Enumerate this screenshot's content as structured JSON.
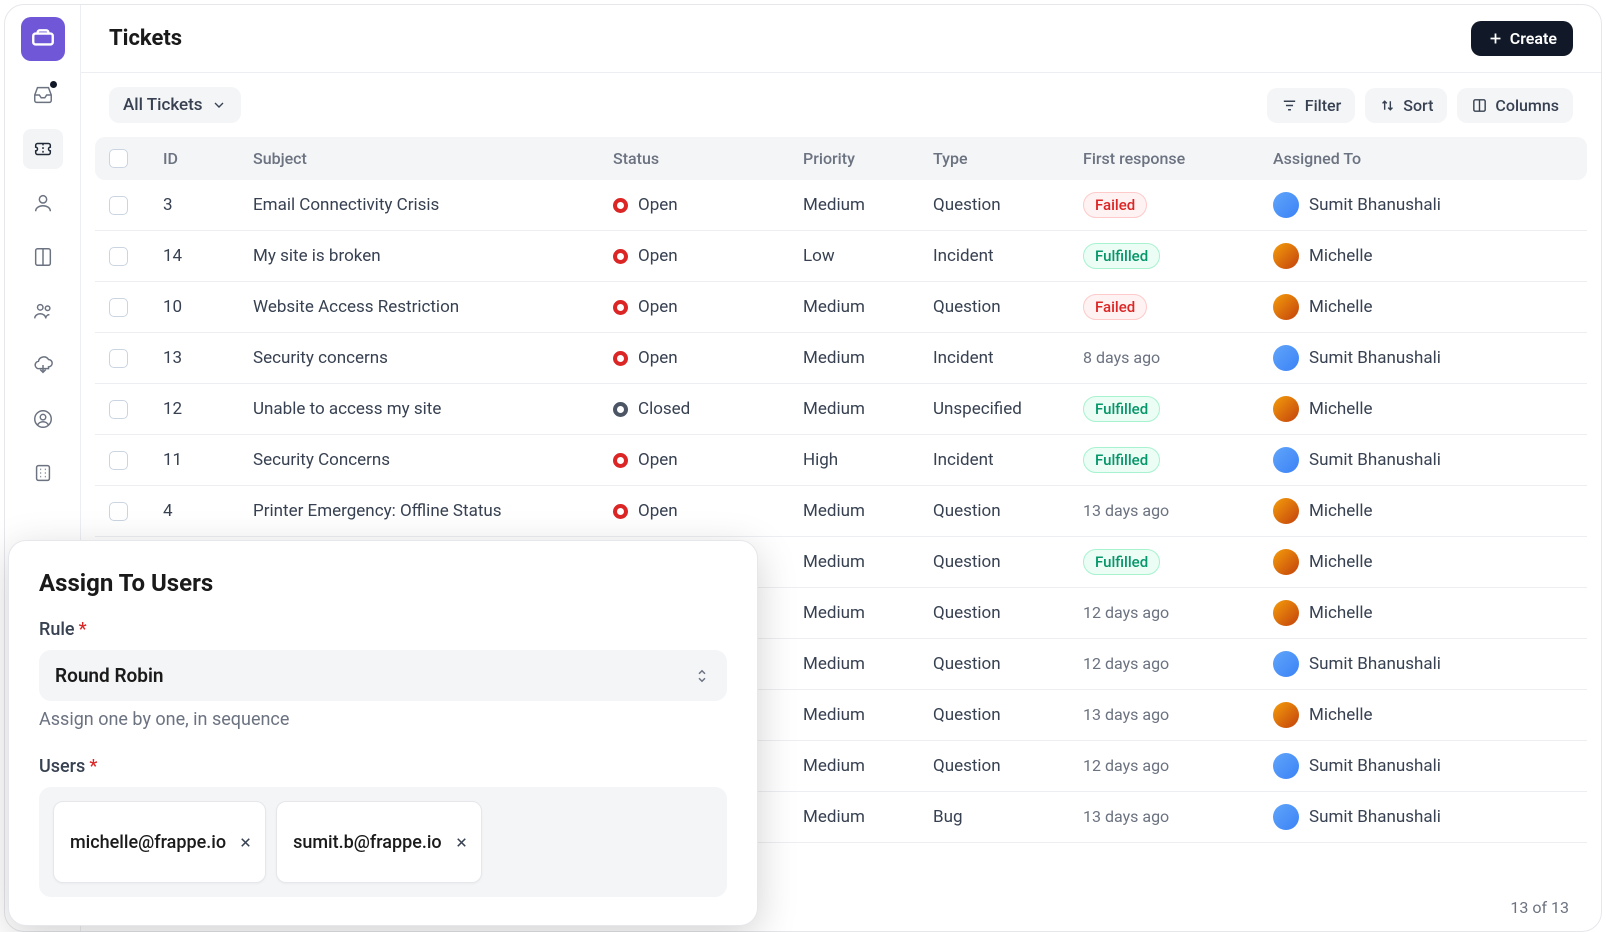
{
  "header": {
    "title": "Tickets",
    "create_label": "Create"
  },
  "toolbar": {
    "dropdown_label": "All Tickets",
    "filter_label": "Filter",
    "sort_label": "Sort",
    "columns_label": "Columns"
  },
  "columns": {
    "id": "ID",
    "subject": "Subject",
    "status": "Status",
    "priority": "Priority",
    "type": "Type",
    "first_response": "First response",
    "assigned_to": "Assigned To"
  },
  "rows": [
    {
      "id": "3",
      "subject": "Email Connectivity Crisis",
      "status": "Open",
      "priority": "Medium",
      "type": "Question",
      "first_response": {
        "kind": "badge",
        "value": "Failed"
      },
      "assigned": {
        "name": "Sumit Bhanushali",
        "avatar": "a1"
      }
    },
    {
      "id": "14",
      "subject": "My site is broken",
      "status": "Open",
      "priority": "Low",
      "type": "Incident",
      "first_response": {
        "kind": "badge",
        "value": "Fulfilled"
      },
      "assigned": {
        "name": "Michelle",
        "avatar": "a2"
      }
    },
    {
      "id": "10",
      "subject": "Website Access Restriction",
      "status": "Open",
      "priority": "Medium",
      "type": "Question",
      "first_response": {
        "kind": "badge",
        "value": "Failed"
      },
      "assigned": {
        "name": "Michelle",
        "avatar": "a2"
      }
    },
    {
      "id": "13",
      "subject": "Security concerns",
      "status": "Open",
      "priority": "Medium",
      "type": "Incident",
      "first_response": {
        "kind": "text",
        "value": "8 days ago"
      },
      "assigned": {
        "name": "Sumit Bhanushali",
        "avatar": "a1"
      }
    },
    {
      "id": "12",
      "subject": "Unable to access my site",
      "status": "Closed",
      "priority": "Medium",
      "type": "Unspecified",
      "first_response": {
        "kind": "badge",
        "value": "Fulfilled"
      },
      "assigned": {
        "name": "Michelle",
        "avatar": "a2"
      }
    },
    {
      "id": "11",
      "subject": "Security Concerns",
      "status": "Open",
      "priority": "High",
      "type": "Incident",
      "first_response": {
        "kind": "badge",
        "value": "Fulfilled"
      },
      "assigned": {
        "name": "Sumit Bhanushali",
        "avatar": "a1"
      }
    },
    {
      "id": "4",
      "subject": "Printer Emergency: Offline Status",
      "status": "Open",
      "priority": "Medium",
      "type": "Question",
      "first_response": {
        "kind": "text",
        "value": "13 days ago"
      },
      "assigned": {
        "name": "Michelle",
        "avatar": "a2"
      }
    },
    {
      "id": "",
      "subject": "",
      "status": "",
      "priority": "Medium",
      "type": "Question",
      "first_response": {
        "kind": "badge",
        "value": "Fulfilled"
      },
      "assigned": {
        "name": "Michelle",
        "avatar": "a2"
      }
    },
    {
      "id": "",
      "subject": "",
      "status": "",
      "priority": "Medium",
      "type": "Question",
      "first_response": {
        "kind": "text",
        "value": "12 days ago"
      },
      "assigned": {
        "name": "Michelle",
        "avatar": "a2"
      }
    },
    {
      "id": "",
      "subject": "",
      "status": "",
      "priority": "Medium",
      "type": "Question",
      "first_response": {
        "kind": "text",
        "value": "12 days ago"
      },
      "assigned": {
        "name": "Sumit Bhanushali",
        "avatar": "a1"
      }
    },
    {
      "id": "",
      "subject": "",
      "status": "",
      "priority": "Medium",
      "type": "Question",
      "first_response": {
        "kind": "text",
        "value": "13 days ago"
      },
      "assigned": {
        "name": "Michelle",
        "avatar": "a2"
      }
    },
    {
      "id": "",
      "subject": "",
      "status": "",
      "priority": "Medium",
      "type": "Question",
      "first_response": {
        "kind": "text",
        "value": "12 days ago"
      },
      "assigned": {
        "name": "Sumit Bhanushali",
        "avatar": "a1"
      }
    },
    {
      "id": "",
      "subject": "",
      "status": "",
      "priority": "Medium",
      "type": "Bug",
      "first_response": {
        "kind": "text",
        "value": "13 days ago"
      },
      "assigned": {
        "name": "Sumit Bhanushali",
        "avatar": "a1"
      }
    }
  ],
  "footer": {
    "count": "13 of 13"
  },
  "modal": {
    "title": "Assign To Users",
    "rule_label": "Rule",
    "rule_value": "Round Robin",
    "rule_help": "Assign one by one, in sequence",
    "users_label": "Users",
    "chips": [
      "michelle@frappe.io",
      "sumit.b@frappe.io"
    ]
  },
  "sidebar_icons": [
    "inbox-icon",
    "ticket-icon",
    "user-icon",
    "book-icon",
    "team-icon",
    "cloud-icon",
    "profile-icon",
    "building-icon"
  ]
}
